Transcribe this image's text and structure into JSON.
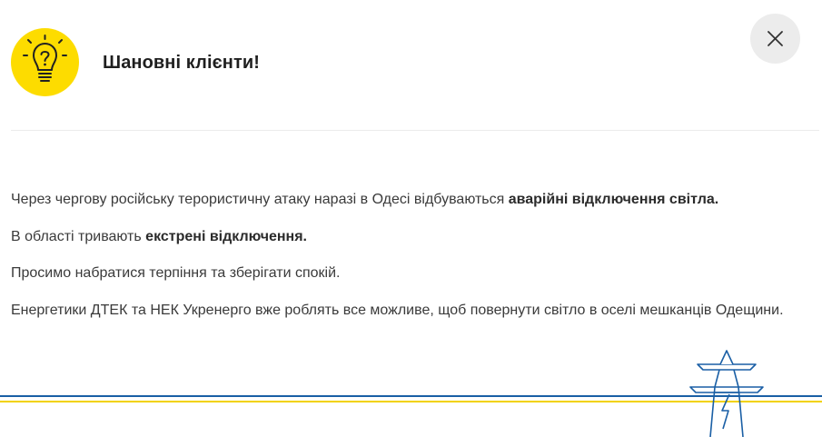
{
  "header": {
    "title": "Шановні клієнти!",
    "icon": "lightbulb-icon",
    "icon_bg": "#fddc00",
    "close_icon": "close-icon"
  },
  "message": {
    "p1_text": "Через чергову російську терористичну атаку наразі в Одесі відбуваються ",
    "p1_bold": "аварійні відключення світла.",
    "p2_text": "В області тривають ",
    "p2_bold": "екстрені відключення.",
    "p3_text": "Просимо набратися терпіння та зберігати спокій.",
    "p4_text": "Енергетики ДТЕК та НЕК Укренерго вже роблять все можливе, щоб повернути світло в оселі мешканців Одещини."
  },
  "decoration": {
    "icon": "power-tower-icon",
    "line_blue": "#1a5fa5",
    "line_yellow": "#f2d200"
  }
}
